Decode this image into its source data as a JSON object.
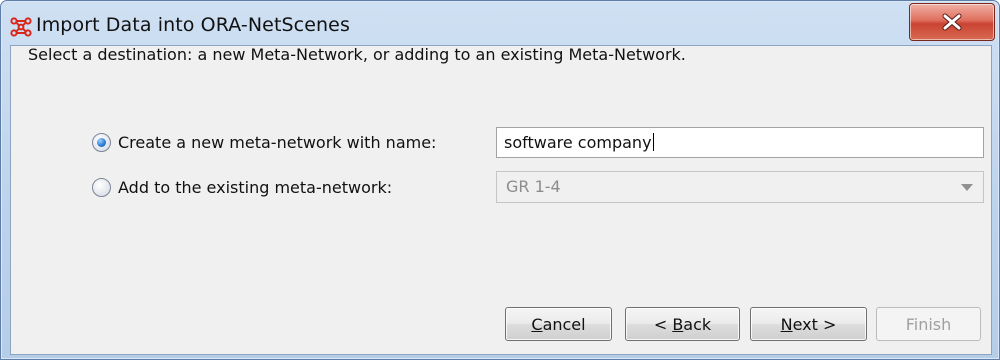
{
  "window": {
    "title": "Import Data into ORA-NetScenes",
    "icon": "ora-app-icon",
    "close_icon": "close-icon",
    "colors": {
      "close_button": "#c94333",
      "titlebar": "#bcd2ec",
      "radio_selected": "#2f7fd6"
    }
  },
  "form": {
    "instruction": "Select a destination: a new Meta-Network, or adding to an existing Meta-Network.",
    "options": [
      {
        "label": "Create a new meta-network with name:",
        "selected": true,
        "field_value": "software company"
      },
      {
        "label": "Add to the existing meta-network:",
        "selected": false,
        "dropdown_value": "GR 1-4",
        "enabled": false
      }
    ]
  },
  "buttons": {
    "cancel": {
      "mnemonic": "C",
      "rest": "ancel"
    },
    "back": {
      "prefix": "< ",
      "mnemonic": "B",
      "rest": "ack"
    },
    "next": {
      "mnemonic": "N",
      "rest": "ext >"
    },
    "finish": {
      "label": "Finish",
      "enabled": false
    }
  }
}
